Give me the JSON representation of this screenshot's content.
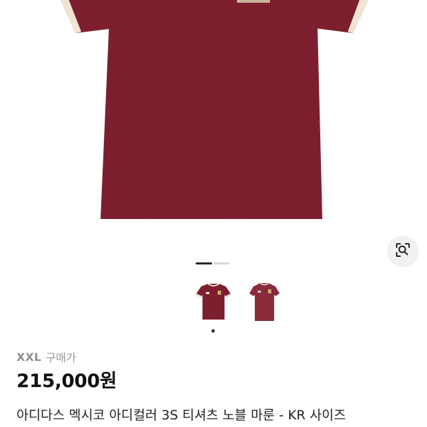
{
  "product": {
    "size": "XXL",
    "price_type": "구매가",
    "price": "215,000원",
    "title": "아디다스 멕시코 아디컬러 3S 티셔츠 노블 마룬 - KR 사이즈"
  },
  "gallery": {
    "total_pages": 2,
    "current_page": 1,
    "thumbnail_count": 2,
    "selected_thumbnail": 1
  },
  "colors": {
    "shirt": "#7d1f2e",
    "cuff": "#f1e4d1",
    "text_primary": "#111111",
    "text_muted": "#9a9a9a"
  },
  "icons": {
    "lens": "image-search-icon"
  }
}
